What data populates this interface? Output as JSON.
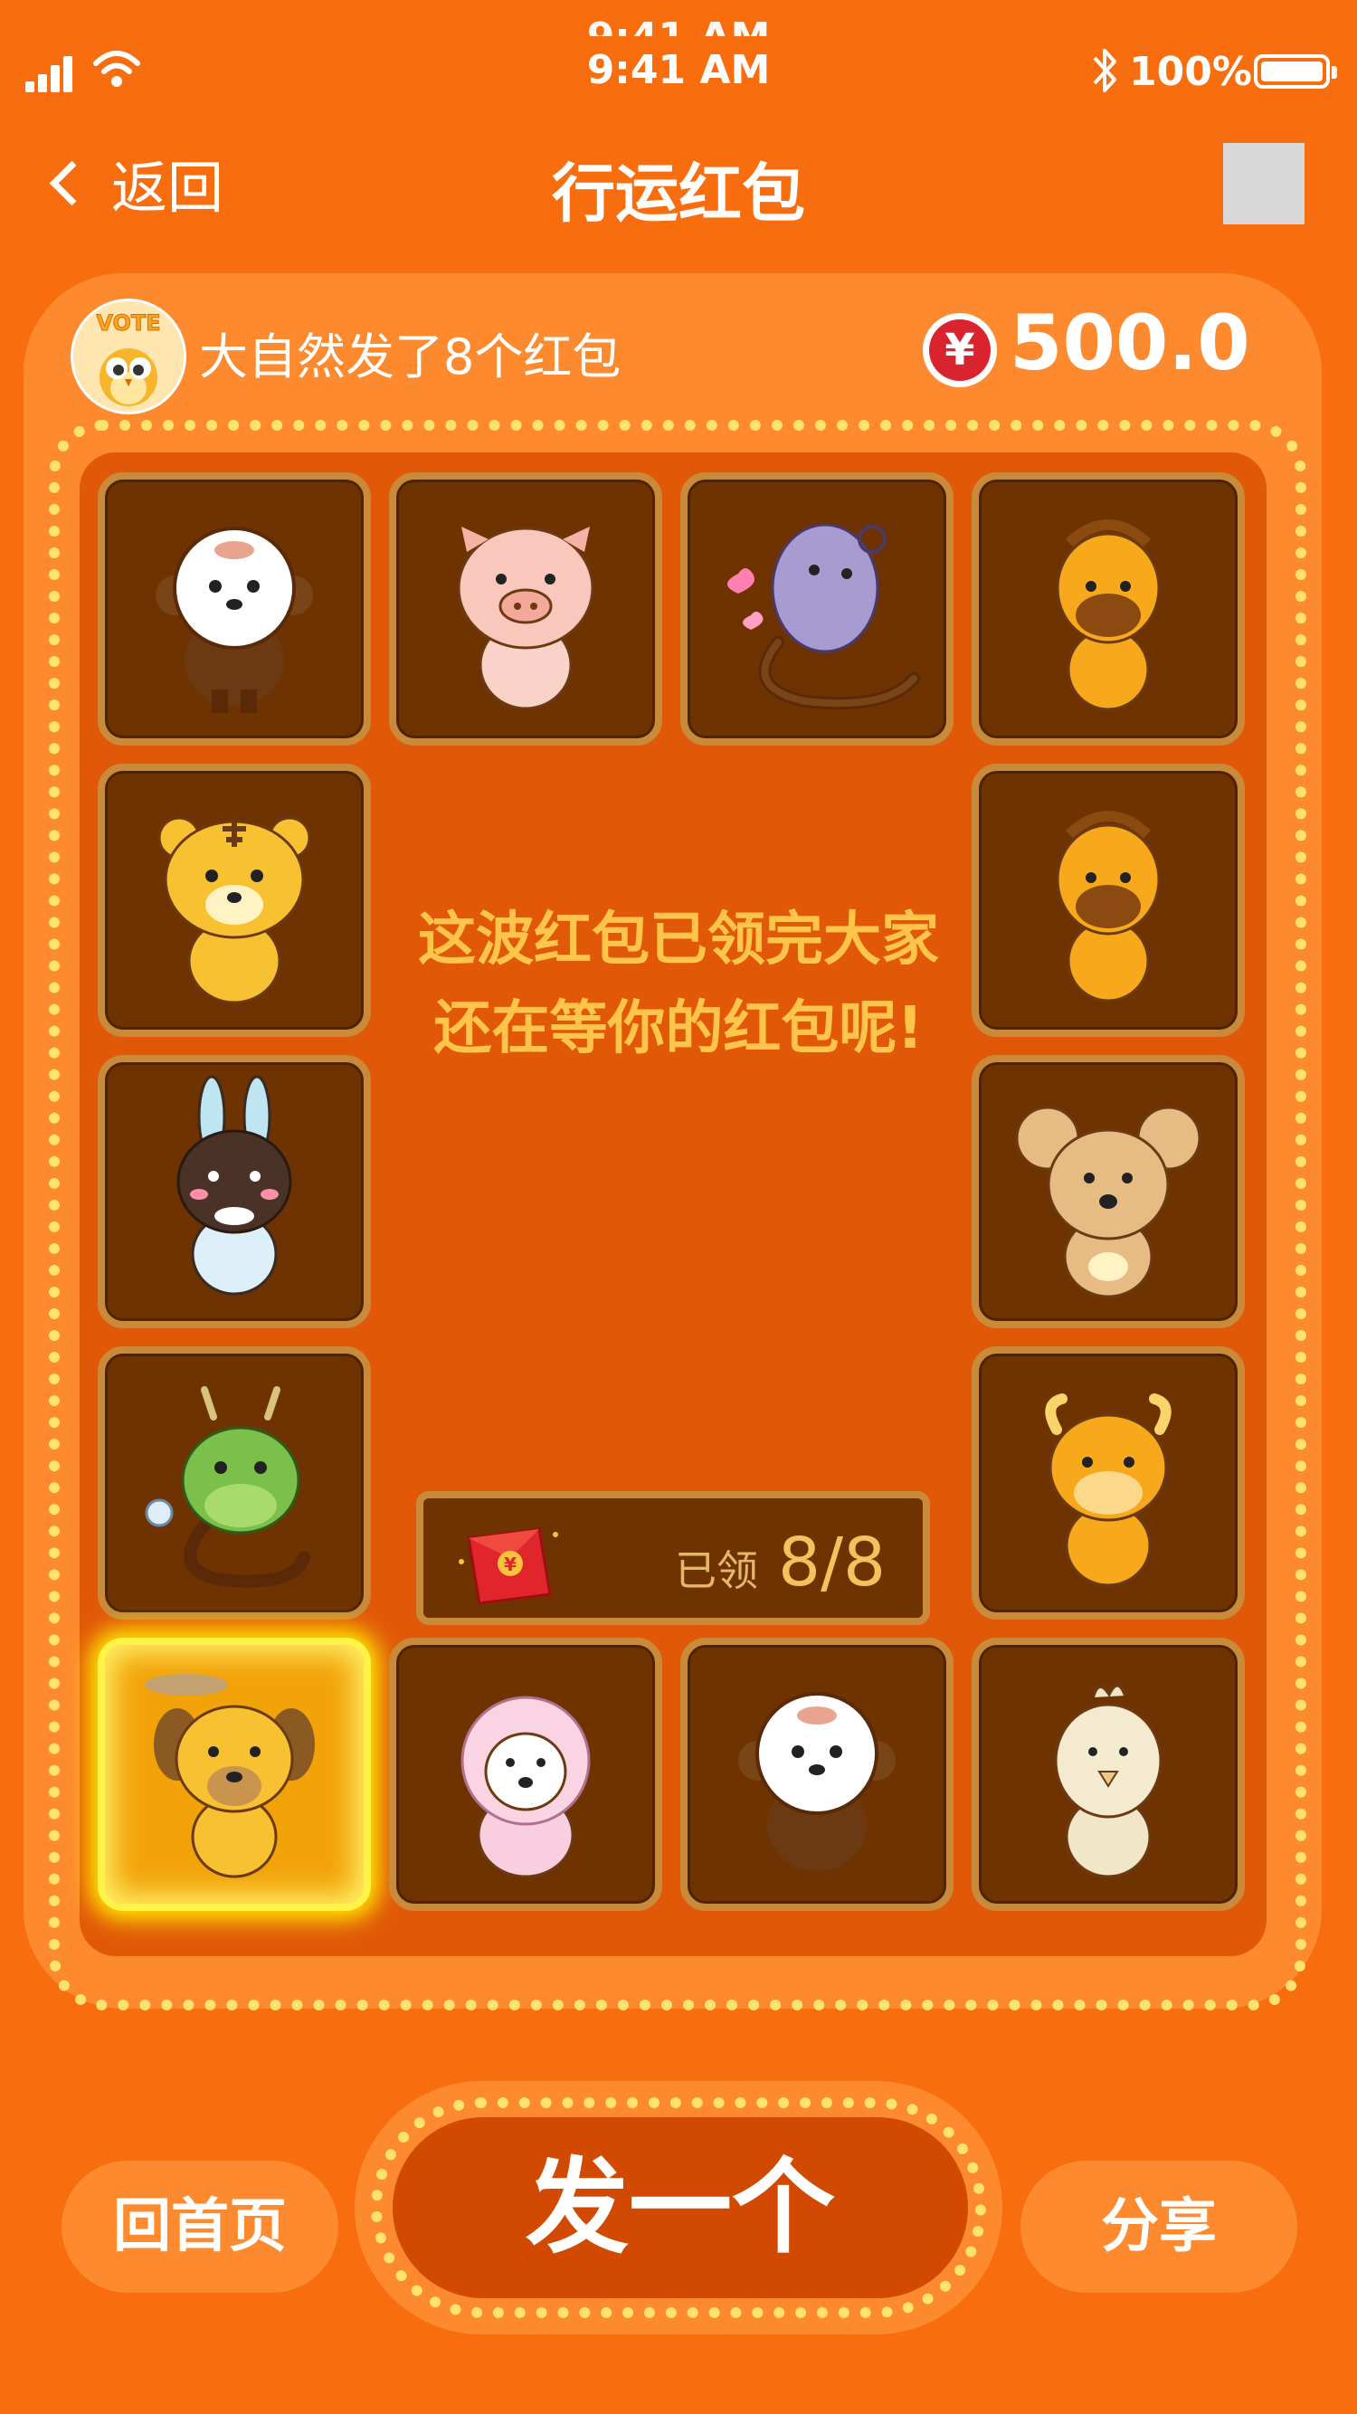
{
  "status_bar": {
    "time": "9:41 AM",
    "ghost_time": "9:41 AM",
    "battery": "100%"
  },
  "nav": {
    "back_label": "返回",
    "title": "行运红包"
  },
  "card": {
    "avatar_text": "VOTE",
    "sender_text": "大自然发了8个红包",
    "currency_symbol": "¥",
    "amount": "500.0"
  },
  "board": {
    "tiles": [
      {
        "animal": "monkey-icon"
      },
      {
        "animal": "pig-icon"
      },
      {
        "animal": "snake-icon"
      },
      {
        "animal": "horse-icon"
      },
      {
        "animal": "tiger-icon"
      },
      {
        "animal": "horse-icon"
      },
      {
        "animal": "rabbit-icon"
      },
      {
        "animal": "rat-icon"
      },
      {
        "animal": "dragon-icon"
      },
      {
        "animal": "ox-icon"
      },
      {
        "animal": "dog-icon"
      },
      {
        "animal": "sheep-icon"
      },
      {
        "animal": "monkey-icon"
      },
      {
        "animal": "rooster-icon"
      }
    ],
    "message": "这波红包已领完大家还在等你的红包呢!",
    "claimed_label": "已领",
    "claimed_count": "8/8",
    "envelope_symbol": "¥"
  },
  "actions": {
    "home_label": "回首页",
    "send_label": "发一个",
    "share_label": "分享"
  },
  "colors": {
    "background": "#F86E0F",
    "card": "#FE8A2F",
    "board": "#E15908",
    "tile": "#6F3302",
    "tile_border": "#C98B3A",
    "highlight": "#FFF34A",
    "message_text": "#FFC54A",
    "send_button": "#D24A02"
  }
}
